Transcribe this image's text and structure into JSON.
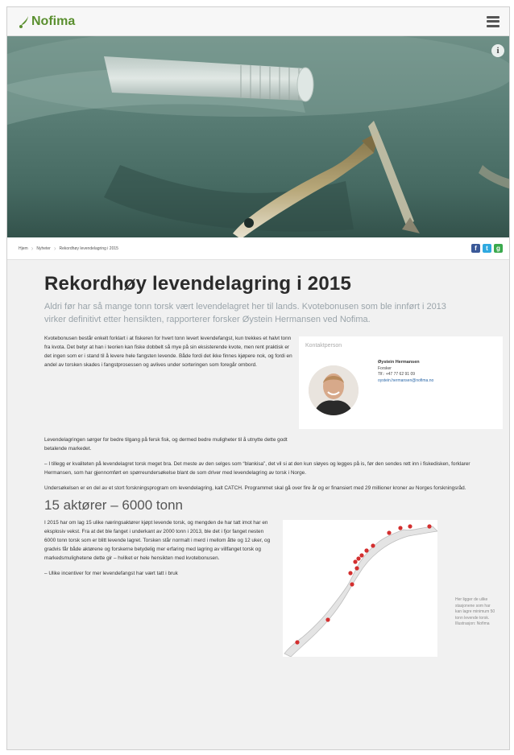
{
  "header": {
    "logo_text": "Nofima",
    "menu_icon": "hamburger-menu-icon",
    "brand_color": "#5a8f2f"
  },
  "hero": {
    "info_label": "i"
  },
  "breadcrumb": {
    "items": [
      "Hjem",
      "Nyheter",
      "Rekordhøy levendelagring i 2015"
    ]
  },
  "share": {
    "facebook": "f",
    "twitter": "t",
    "google": "g"
  },
  "article": {
    "title": "Rekordhøy levendelagring i 2015",
    "lead": "Aldri før har så mange tonn torsk vært levendelagret her til lands. Kvotebonusen som ble innført i 2013 virker definitivt etter hensikten, rapporterer forsker Øystein Hermansen ved Nofima.",
    "p1": "Kvotebonusen består enkelt forklart i at fiskeren for hvert tonn levert levendefangst, kun trekkes et halvt tonn fra kvota. Det betyr at han i teorien kan fiske dobbelt så mye på sin eksisterende kvote, men rent praktisk er det ingen som er i stand til å levere hele fangsten levende. Både fordi det ikke finnes kjøpere nok, og fordi en andel av torsken skades i fangstprosessen og avlives under sorteringen som foregår ombord.",
    "p2": "Levendelagringen sørger for bedre tilgang på fersk fisk, og dermed bedre muligheter til å utnytte dette godt betalende markedet.",
    "p3": "– I tillegg er kvaliteten på levendelagret torsk meget bra. Det meste av den selges som “blankisa”, det vil si at den kun sløyes og legges på is, før den sendes rett inn i fiskedisken, forklarer Hermansen, som har gjennomført en spørreundersøkelse blant de som driver med levendelagring av torsk i Norge.",
    "p4": "Undersøkelsen er en del av et stort forskningsprogram om levendelagring, kalt CATCH. Programmet skal gå over fire år og er finansiert med 29 millioner kroner av Norges forskningsråd.",
    "subheading": "15 aktører – 6000 tonn",
    "p5": "I 2015 har om lag 15 ulike næringsaktører kjøpt levende torsk, og mengden de har tatt imot har en eksplosiv vekst. Fra at det ble fanget i underkant av 2000 tonn i 2013, ble det i fjor fanget nesten 6000 tonn torsk som er blitt levende lagret. Torsken står normalt i merd i mellom åtte og 12 uker, og gradvis får både aktørene og forskerne betydelig mer erfaring med lagring av villfanget torsk og markedsmulighetene dette gir – hvilket er hele hensikten med kvotebonusen.",
    "p6": "– Ulike incentiver for mer levendefangst har vært tatt i bruk"
  },
  "contact": {
    "title": "Kontaktperson",
    "name": "Øystein Hermansen",
    "role": "Forsker",
    "phone": "Tlf.: +47 77 62 91 09",
    "email": "oystein.hermansen@nofima.no"
  },
  "map": {
    "caption": "Her ligger de ulike stasjonene som har kan lagre minimum 50 tonn levende torsk. Illustrasjon: Nofima",
    "marker_color": "#d32f2f"
  }
}
